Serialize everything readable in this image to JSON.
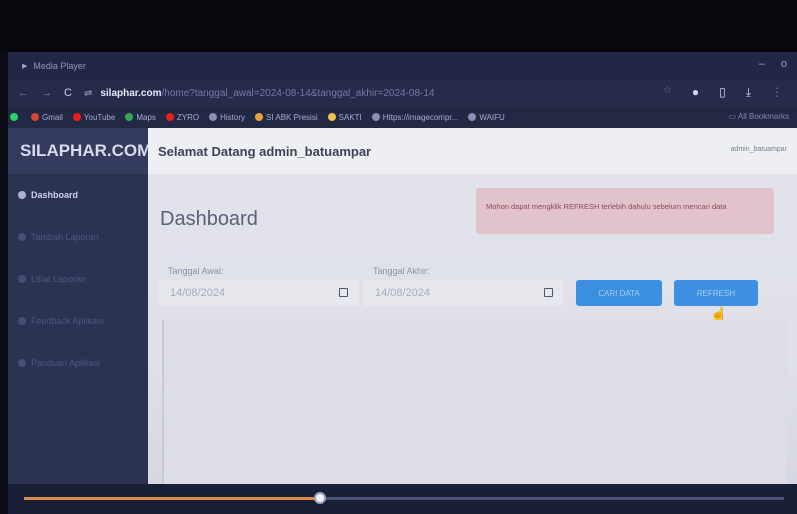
{
  "window": {
    "title": "Media Player",
    "controls": [
      "–",
      "o"
    ]
  },
  "browser": {
    "site": "silaphar.com",
    "path": "/home?tanggal_awal=2024-08-14&tanggal_akhir=2024-08-14",
    "bookmarks": [
      {
        "label": "Gmail",
        "color": "#d44638"
      },
      {
        "label": "YouTube",
        "color": "#e62117"
      },
      {
        "label": "Maps",
        "color": "#34a853"
      },
      {
        "label": "ZYRO",
        "color": "#6d4aff"
      },
      {
        "label": "History",
        "color": "#8a8fb5"
      },
      {
        "label": "SI ABK Presisi",
        "color": "#e8a23a"
      },
      {
        "label": "SAKTI",
        "color": "#f0c14b"
      },
      {
        "label": "Https://imagecompr...",
        "color": "#8a8fb5"
      },
      {
        "label": "WAIFU",
        "color": "#8a8fb5"
      }
    ],
    "all_bookmarks": "All Bookmarks"
  },
  "sidebar": {
    "brand": "SILAPHAR.COM",
    "items": [
      {
        "label": "Dashboard",
        "active": true
      },
      {
        "label": "Tambah Laporan",
        "active": false
      },
      {
        "label": "Lihat Laporan",
        "active": false
      },
      {
        "label": "Feedback Aplikasi",
        "active": false
      },
      {
        "label": "Panduan Aplikasi",
        "active": false
      }
    ]
  },
  "header": {
    "welcome": "Selamat Datang admin_batuampar",
    "user": "admin_batuampar"
  },
  "main": {
    "title": "Dashboard",
    "alert": "Mohon dapat mengklik REFRESH terlebih dahulu sebelum mencari data",
    "start_label": "Tanggal Awal:",
    "start_value": "14/08/2024",
    "end_label": "Tanggal Akhir:",
    "end_value": "14/08/2024",
    "search_button": "CARI DATA",
    "refresh_button": "REFRESH"
  },
  "media": {
    "progress": 0.39
  }
}
